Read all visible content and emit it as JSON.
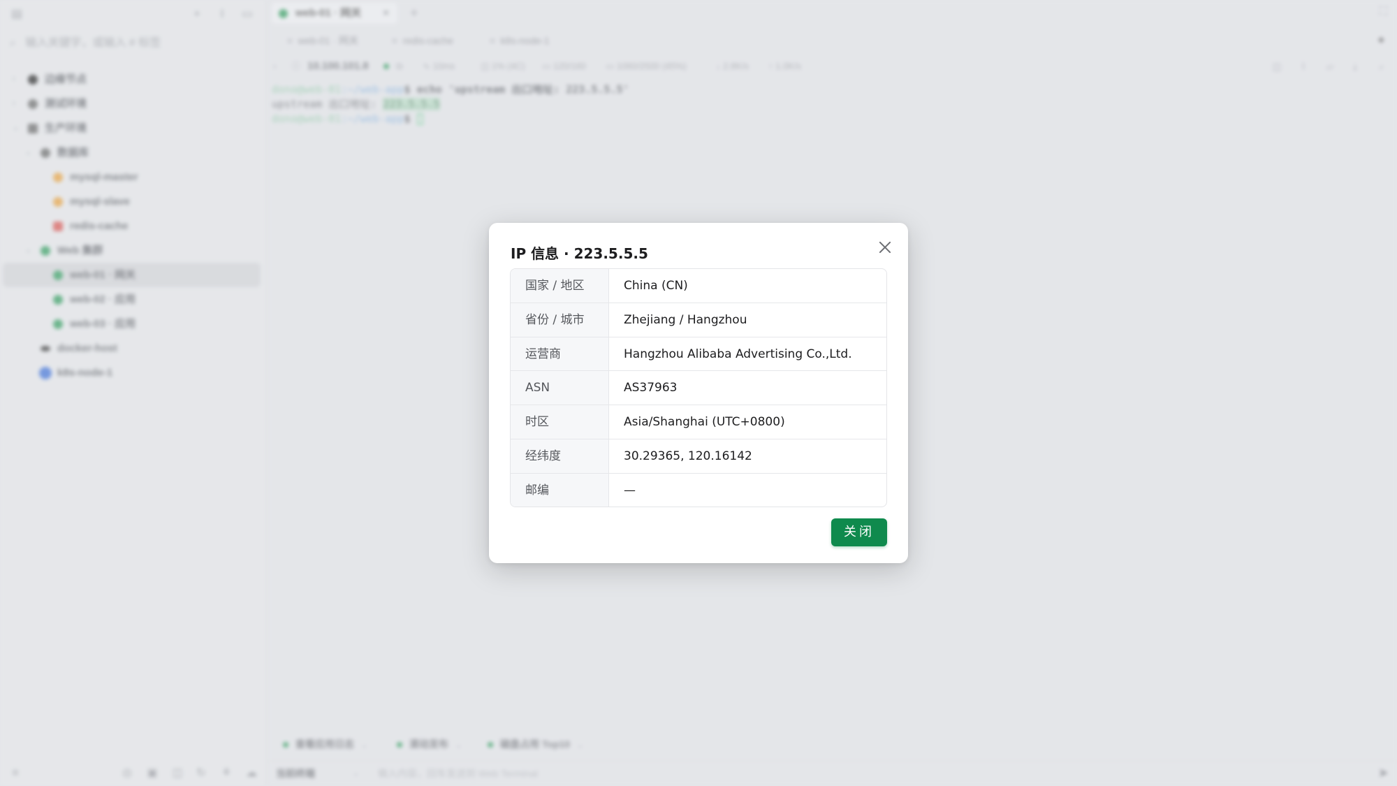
{
  "sidebar": {
    "search_placeholder": "输入关键字，或输入 # 标签",
    "tree": [
      {
        "label": "边缘节点",
        "color": "#222"
      },
      {
        "label": "测试环境",
        "color": "#666"
      },
      {
        "label": "生产环境",
        "color": "#666"
      },
      {
        "label": "数据库",
        "color": "#666"
      },
      {
        "label": "mysql-master",
        "color": "#e8a03a"
      },
      {
        "label": "mysql-slave",
        "color": "#e8a03a"
      },
      {
        "label": "redis-cache",
        "color": "#d9534f"
      },
      {
        "label": "Web 集群",
        "color": "#2e9b5c"
      },
      {
        "label": "web-01 · 网关",
        "color": "#2e9b5c"
      },
      {
        "label": "web-02 · 应用",
        "color": "#2e9b5c"
      },
      {
        "label": "web-03 · 应用",
        "color": "#2e9b5c"
      },
      {
        "label": "docker-host",
        "color": "#333"
      },
      {
        "label": "k8s-node-1",
        "color": "#3b6fd8"
      }
    ]
  },
  "tabs": {
    "active_label": "web-01 · 网关"
  },
  "subtabs": [
    "web-01 · 网关",
    "redis-cache",
    "k8s-node-1"
  ],
  "status": {
    "host": "10.100.101.8",
    "latency": "10ms",
    "cpu": "1% (4C)",
    "mem": "120/160",
    "disk": "1060/2500 (45%)",
    "down": "2.8K/s",
    "up": "1.0K/s"
  },
  "terminal": {
    "prompt": "dono@web-01",
    "path": ":~/web-app",
    "command": "$ echo 'upstream 出口地址: 223.5.5.5'",
    "output_prefix": "upstream 出口地址: ",
    "output_ip": "223.5.5.5",
    "prompt2": "dono@web-01",
    "path2": ":~/web-app",
    "dollar2": "$ "
  },
  "quickbar": [
    "查看应用日志",
    "滚动发布",
    "磁盘占用 Top10"
  ],
  "inputbar": {
    "target": "当前终端",
    "placeholder": "输入内容，回车发送到 Web Terminal"
  },
  "dialog": {
    "title": "IP 信息 · 223.5.5.5",
    "rows": [
      {
        "key": "国家 / 地区",
        "value": "China (CN)"
      },
      {
        "key": "省份 / 城市",
        "value": "Zhejiang / Hangzhou"
      },
      {
        "key": "运营商",
        "value": "Hangzhou Alibaba Advertising Co.,Ltd."
      },
      {
        "key": "ASN",
        "value": "AS37963"
      },
      {
        "key": "时区",
        "value": "Asia/Shanghai (UTC+0800)"
      },
      {
        "key": "经纬度",
        "value": "30.29365, 120.16142"
      },
      {
        "key": "邮编",
        "value": "—"
      }
    ],
    "close_button": "关闭"
  },
  "colors": {
    "primary": "#0f8a4d",
    "accent_green": "#2e9b5c"
  }
}
